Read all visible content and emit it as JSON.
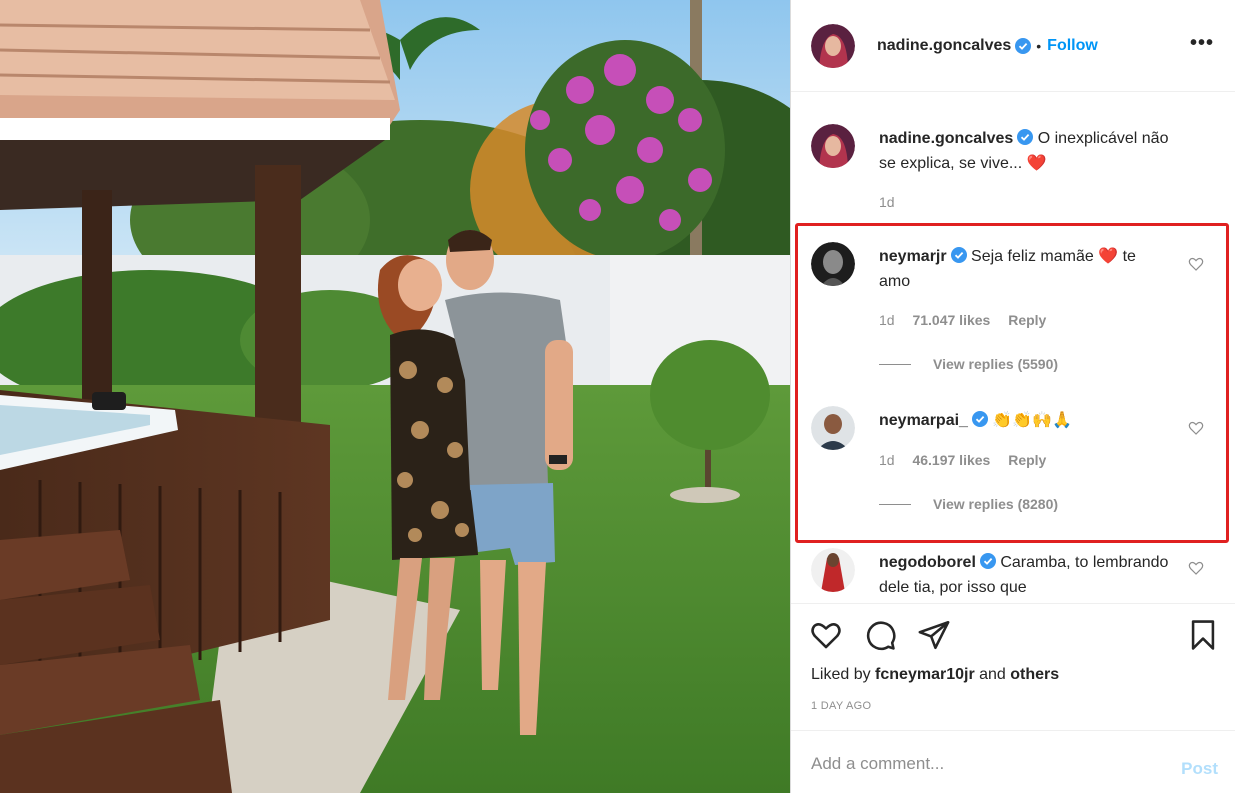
{
  "post": {
    "author": "nadine.goncalves",
    "follow_label": "Follow",
    "dot": "•",
    "more_label": "•••",
    "caption": "O inexplicável não se explica, se vive...",
    "caption_emoji": "❤️",
    "caption_age": "1d"
  },
  "comments": [
    {
      "user": "neymarjr",
      "text": "Seja feliz mamãe",
      "text_after": "te amo",
      "emoji": "❤️",
      "age": "1d",
      "likes": "71.047 likes",
      "reply_label": "Reply",
      "view_replies": "View replies (5590)"
    },
    {
      "user": "neymarpai_",
      "text": "",
      "emoji": "👏👏🙌🙏",
      "age": "1d",
      "likes": "46.197 likes",
      "reply_label": "Reply",
      "view_replies": "View replies (8280)"
    },
    {
      "user": "negodoborel",
      "text": "Caramba, to lembrando dele tia, por isso que"
    }
  ],
  "actions": {
    "liked_prefix": "Liked by",
    "liked_user": "fcneymar10jr",
    "liked_and": "and",
    "liked_others": "others",
    "time_ago": "1 DAY AGO"
  },
  "comment_box": {
    "placeholder": "Add a comment...",
    "post_label": "Post"
  },
  "colors": {
    "link_blue": "#0095f6",
    "verified_blue": "#3897f0",
    "highlight_red": "#e02020",
    "muted_gray": "#8e8e8e",
    "heart_red": "#ed4956"
  }
}
